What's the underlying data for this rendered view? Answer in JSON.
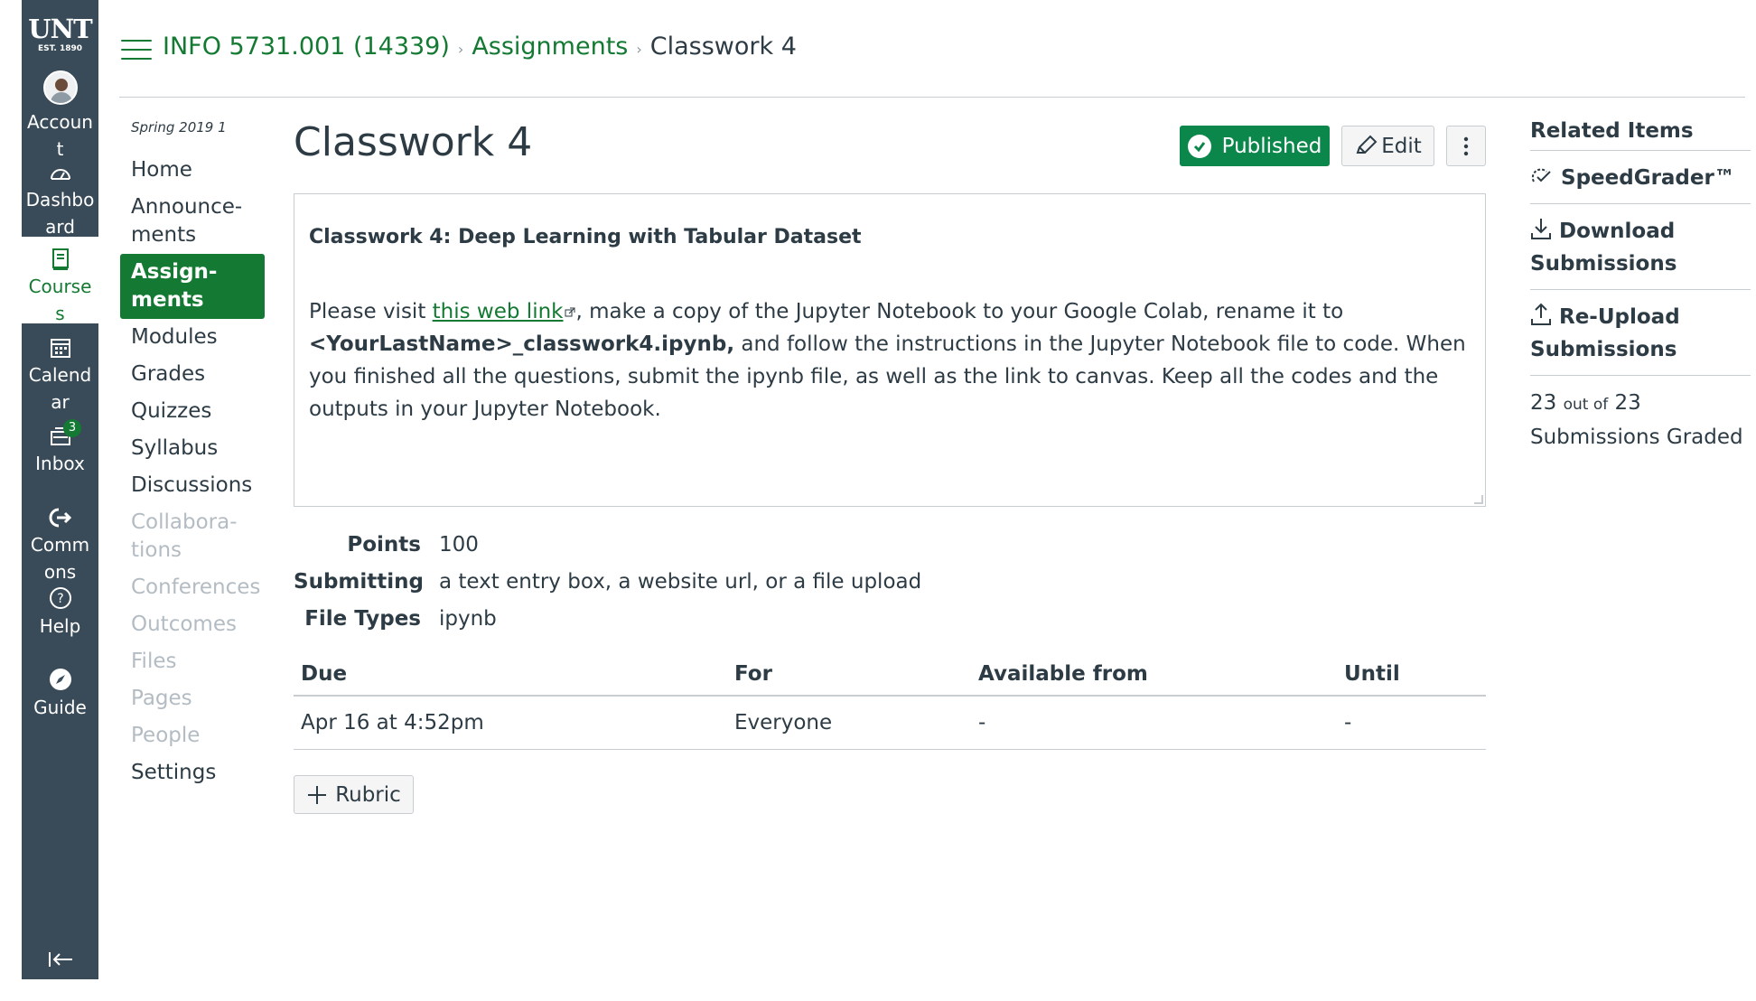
{
  "global_nav": {
    "logo": {
      "name": "UNT",
      "est": "EST. 1890"
    },
    "items": [
      {
        "label": "Accoun\nt"
      },
      {
        "label": "Dashbo\nard"
      },
      {
        "label": "Course\ns"
      },
      {
        "label": "Calend\nar"
      },
      {
        "label": "Inbox",
        "badge": "3"
      },
      {
        "label": "Comm\nons"
      },
      {
        "label": "Help"
      },
      {
        "label": "Guide"
      }
    ]
  },
  "breadcrumb": {
    "course": "INFO 5731.001 (14339)",
    "section": "Assignments",
    "current": "Classwork 4"
  },
  "course_nav": {
    "term": "Spring 2019 1",
    "items": [
      {
        "label": "Home"
      },
      {
        "label": "Announce-\nments"
      },
      {
        "label": "Assign-\nments"
      },
      {
        "label": "Modules"
      },
      {
        "label": "Grades"
      },
      {
        "label": "Quizzes"
      },
      {
        "label": "Syllabus"
      },
      {
        "label": "Discussions"
      },
      {
        "label": "Collabora-\ntions"
      },
      {
        "label": "Conferences"
      },
      {
        "label": "Outcomes"
      },
      {
        "label": "Files"
      },
      {
        "label": "Pages"
      },
      {
        "label": "People"
      },
      {
        "label": "Settings"
      }
    ]
  },
  "assignment": {
    "title": "Classwork 4",
    "published_label": "Published",
    "edit_label": "Edit",
    "description": {
      "heading": "Classwork 4: Deep Learning with Tabular Dataset",
      "text_before_link": "Please visit ",
      "link_text": "this web link",
      "text_after_link": ", make a copy of the Jupyter Notebook to your Google Colab, rename it to ",
      "bold_text": "<YourLastName>_classwork4.ipynb,",
      "text_end": " and follow the instructions in the Jupyter Notebook file to code. When you finished all the questions, submit the ipynb file, as well as the link to canvas. Keep all the codes and the outputs in your Jupyter Notebook."
    },
    "details": [
      {
        "key": "Points",
        "value": "100"
      },
      {
        "key": "Submitting",
        "value": "a text entry box, a website url, or a file upload"
      },
      {
        "key": "File Types",
        "value": "ipynb"
      }
    ],
    "dates_table": {
      "headers": [
        "Due",
        "For",
        "Available from",
        "Until"
      ],
      "row": [
        "Apr 16 at 4:52pm",
        "Everyone",
        "-",
        "-"
      ]
    },
    "rubric_label": "Rubric"
  },
  "related": {
    "title": "Related Items",
    "speedgrader": "SpeedGrader™",
    "download": "Download\nSubmissions",
    "reupload": "Re-Upload\nSubmissions",
    "graded_count": "23",
    "graded_out_of": "out of",
    "graded_total": "23",
    "graded_suffix": "Submissions Graded"
  },
  "colors": {
    "brand_green": "#147a33",
    "published_green": "#0b874b",
    "nav_bg": "#394b58",
    "text": "#2d3b45"
  },
  "icons": [
    "hamburger-icon",
    "account-avatar",
    "dashboard-icon",
    "courses-icon",
    "calendar-icon",
    "inbox-icon",
    "commons-icon",
    "help-icon",
    "guide-icon",
    "collapse-nav-icon",
    "check-circle-icon",
    "pencil-icon",
    "kebab-icon",
    "external-link-icon",
    "plus-icon",
    "speedgrader-icon",
    "download-icon",
    "upload-icon"
  ]
}
